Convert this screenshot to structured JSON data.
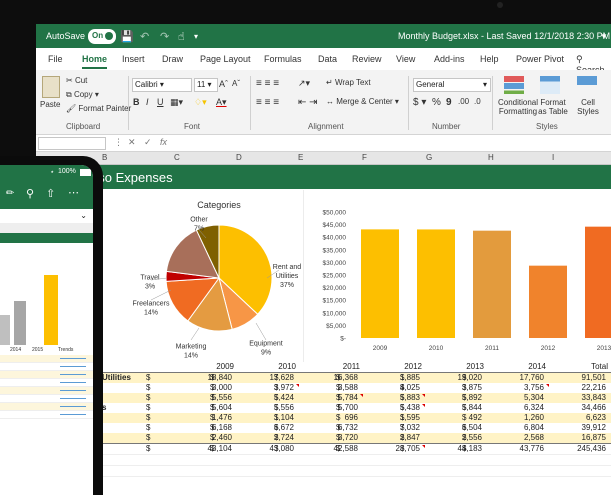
{
  "window": {
    "autosave_label": "AutoSave",
    "autosave_state": "On",
    "doc_title": "Monthly Budget.xlsx - Last Saved 12/1/2018 2:30 PM"
  },
  "tabs": [
    "File",
    "Home",
    "Insert",
    "Draw",
    "Page Layout",
    "Formulas",
    "Data",
    "Review",
    "View",
    "Add-ins",
    "Help",
    "Power Pivot"
  ],
  "search_label": "Search",
  "ribbon": {
    "paste": "Paste",
    "cut": "Cut",
    "copy": "Copy",
    "format_painter": "Format Painter",
    "clipboard": "Clipboard",
    "font_name": "Calibri",
    "font_size": "11",
    "font": "Font",
    "wrap_text": "Wrap Text",
    "merge_center": "Merge & Center",
    "alignment": "Alignment",
    "number_format": "General",
    "number": "Number",
    "conditional_formatting": "Conditional Formatting",
    "format_as_table": "Format as Table",
    "cell_styles": "Cell Styles",
    "styles": "Styles"
  },
  "formula_bar": {
    "fx": "fx"
  },
  "columns": [
    "B",
    "C",
    "D",
    "E",
    "F",
    "G",
    "H",
    "I"
  ],
  "sheet_title": "oso Expenses",
  "pie_chart": {
    "title": "Categories",
    "slices": [
      {
        "label": "Rent and Utilities",
        "pct": "37%",
        "value": 37,
        "color": "#fdbf00"
      },
      {
        "label": "Equipment",
        "pct": "9%",
        "value": 9,
        "color": "#f79646"
      },
      {
        "label": "Marketing",
        "pct": "14%",
        "value": 14,
        "color": "#e49b41"
      },
      {
        "label": "Freelancers",
        "pct": "14%",
        "value": 14,
        "color": "#f06b22"
      },
      {
        "label": "Travel",
        "pct": "3%",
        "value": 3,
        "color": "#c00000"
      },
      {
        "label": "Other",
        "pct": "7%",
        "value": 7,
        "color": "#7f6000"
      }
    ],
    "extra_slice": {
      "value": 16,
      "color": "#a86f5a"
    }
  },
  "chart_data": {
    "type": "bar",
    "categories": [
      "2009",
      "2010",
      "2011",
      "2012",
      "2013"
    ],
    "values": [
      43104,
      43080,
      42588,
      28705,
      44183
    ],
    "colors": [
      "#fdbf00",
      "#fdbf00",
      "#e39b3d",
      "#f0832c",
      "#f06b22"
    ],
    "ylabels": [
      "$50,000",
      "$45,000",
      "$40,000",
      "$35,000",
      "$30,000",
      "$25,000",
      "$20,000",
      "$15,000",
      "$10,000",
      "$5,000",
      "$-"
    ],
    "ylim": [
      0,
      50000
    ]
  },
  "table": {
    "header": [
      "2009",
      "2010",
      "2011",
      "2012",
      "2013",
      "2014",
      "Total"
    ],
    "rows": [
      {
        "label": "Utilities",
        "vals": [
          "18,840",
          "17,628",
          "16,368",
          "1,885",
          "19,020",
          "17,760",
          "91,501"
        ]
      },
      {
        "label": "",
        "vals": [
          "3,000",
          "3,972",
          "3,588",
          "4,025",
          "3,875",
          "3,756",
          "22,216"
        ]
      },
      {
        "label": "",
        "vals": [
          "5,556",
          "5,424",
          "5,784",
          "5,883",
          "5,892",
          "5,304",
          "33,843"
        ]
      },
      {
        "label": "s",
        "vals": [
          "5,604",
          "5,556",
          "5,700",
          "5,438",
          "5,844",
          "6,324",
          "34,466"
        ]
      },
      {
        "label": "",
        "vals": [
          "1,476",
          "1,104",
          "696",
          "1,595",
          "492",
          "1,260",
          "6,623"
        ]
      },
      {
        "label": "",
        "vals": [
          "6,168",
          "6,672",
          "6,732",
          "7,032",
          "6,504",
          "6,804",
          "39,912"
        ]
      },
      {
        "label": "",
        "vals": [
          "2,460",
          "2,724",
          "3,720",
          "2,847",
          "2,556",
          "2,568",
          "16,875"
        ]
      },
      {
        "label": "",
        "vals": [
          "43,104",
          "43,080",
          "42,588",
          "28,705",
          "44,183",
          "43,776",
          "245,436"
        ]
      }
    ],
    "currency": "$"
  },
  "phone": {
    "battery": "100%",
    "mini_years": [
      "2014",
      "2015",
      "Trends"
    ]
  }
}
